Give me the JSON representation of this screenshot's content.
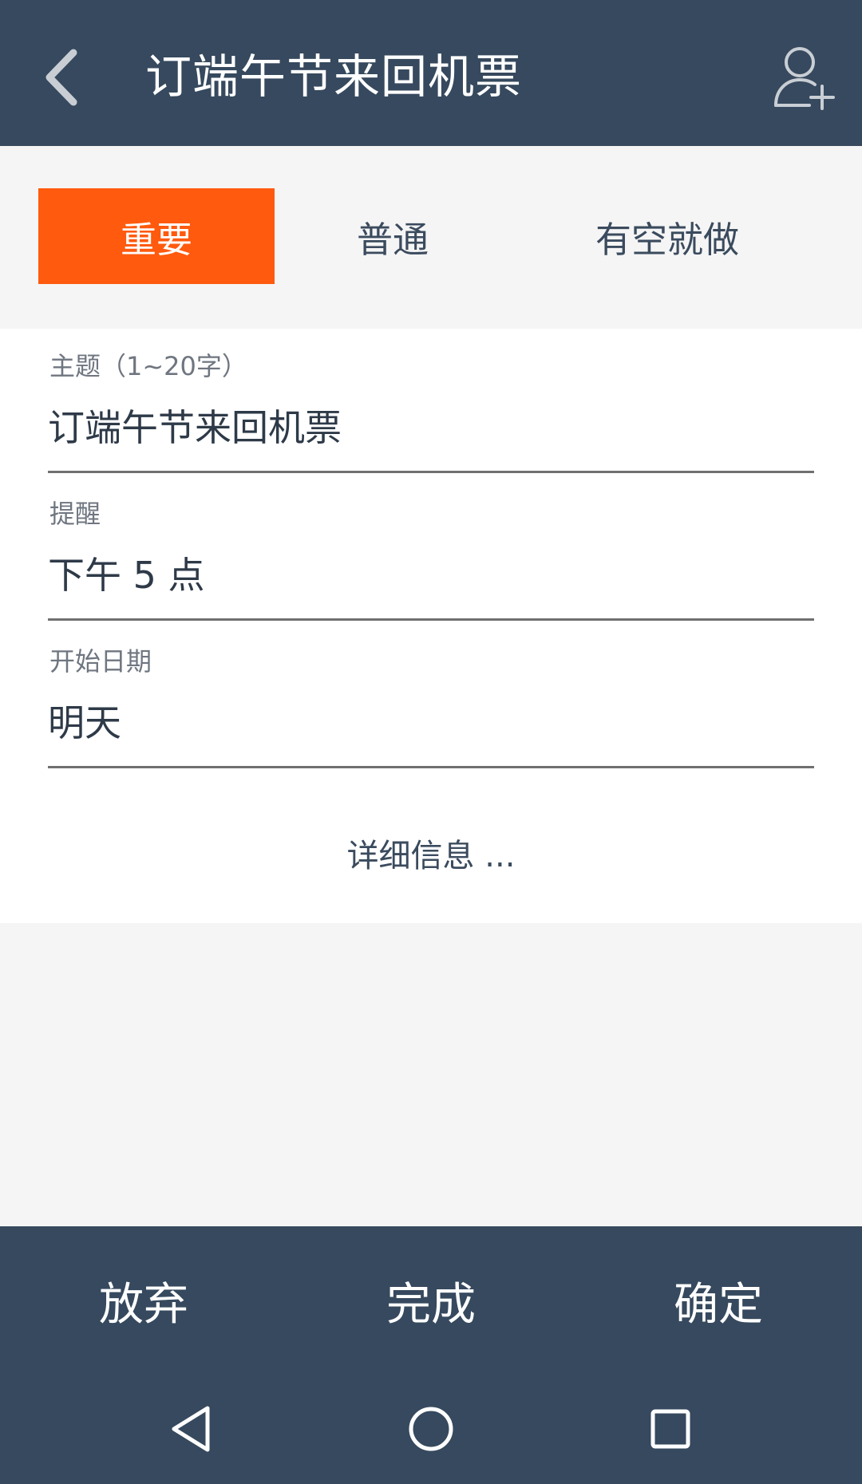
{
  "app_bar": {
    "title": "订端午节来回机票",
    "back_icon": "chevron-left-icon",
    "add_user_icon": "add-user-icon"
  },
  "priority_tabs": {
    "items": [
      {
        "label": "重要",
        "selected": true
      },
      {
        "label": "普通",
        "selected": false
      },
      {
        "label": "有空就做",
        "selected": false
      }
    ],
    "active_color": "#ff5a0e"
  },
  "form": {
    "subject": {
      "label": "主题（1~20字）",
      "value": "订端午节来回机票"
    },
    "reminder": {
      "label": "提醒",
      "value": "下午 5 点"
    },
    "start_date": {
      "label": "开始日期",
      "value": "明天"
    },
    "details_link": "详细信息 ..."
  },
  "actions": {
    "discard": "放弃",
    "done": "完成",
    "confirm": "确定"
  },
  "system_nav": {
    "back_icon": "triangle-back-icon",
    "home_icon": "circle-home-icon",
    "recents_icon": "square-recents-icon"
  },
  "colors": {
    "primary": "#36495e",
    "accent": "#ff5a0e",
    "background": "#f5f5f5"
  }
}
